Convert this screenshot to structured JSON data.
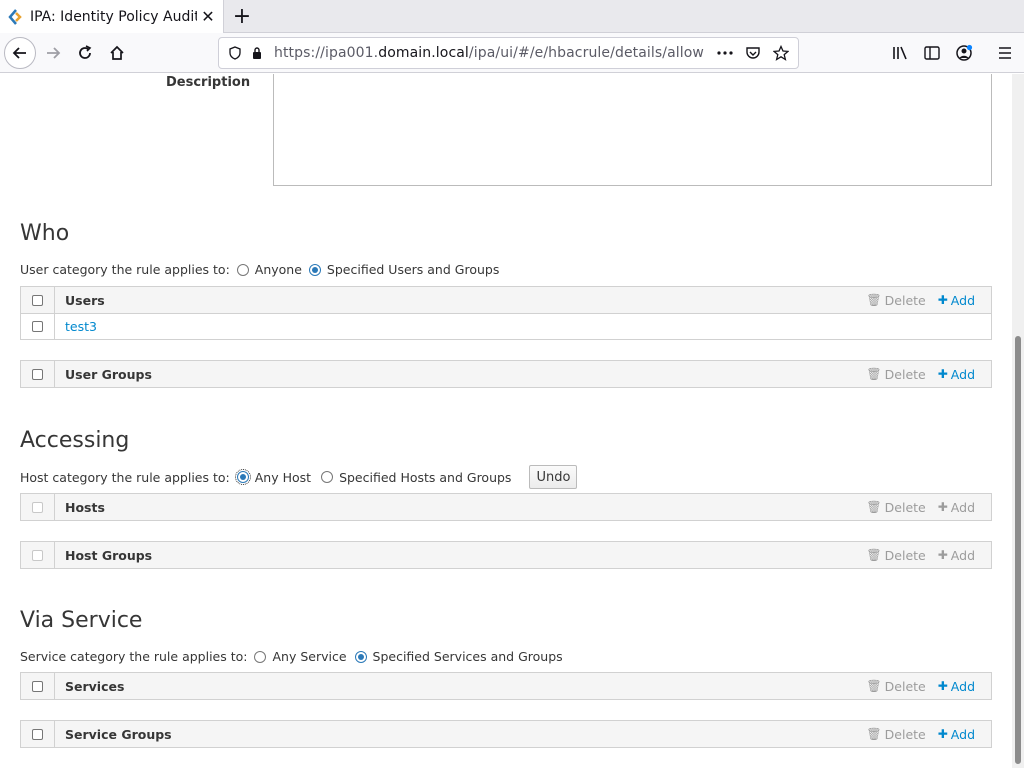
{
  "browser": {
    "tab_title": "IPA: Identity Policy Audit",
    "url_prefix": "https://ipa001.",
    "url_host": "domain.local",
    "url_path": "/ipa/ui/#/e/hbacrule/details/allow"
  },
  "description": {
    "label": "Description",
    "value": ""
  },
  "who": {
    "title": "Who",
    "category_label": "User category the rule applies to:",
    "options": [
      "Anyone",
      "Specified Users and Groups"
    ],
    "selected": "Specified Users and Groups",
    "users_table": {
      "header": "Users",
      "rows": [
        "test3"
      ]
    },
    "groups_table": {
      "header": "User Groups"
    }
  },
  "accessing": {
    "title": "Accessing",
    "category_label": "Host category the rule applies to:",
    "options": [
      "Any Host",
      "Specified Hosts and Groups"
    ],
    "selected": "Any Host",
    "undo_label": "Undo",
    "hosts_table": {
      "header": "Hosts"
    },
    "groups_table": {
      "header": "Host Groups"
    }
  },
  "via_service": {
    "title": "Via Service",
    "category_label": "Service category the rule applies to:",
    "options": [
      "Any Service",
      "Specified Services and Groups"
    ],
    "selected": "Specified Services and Groups",
    "services_table": {
      "header": "Services"
    },
    "groups_table": {
      "header": "Service Groups"
    }
  },
  "actions": {
    "delete_label": "Delete",
    "add_label": "Add"
  },
  "colors": {
    "link": "#0088ce",
    "radio": "#2b79b8"
  }
}
